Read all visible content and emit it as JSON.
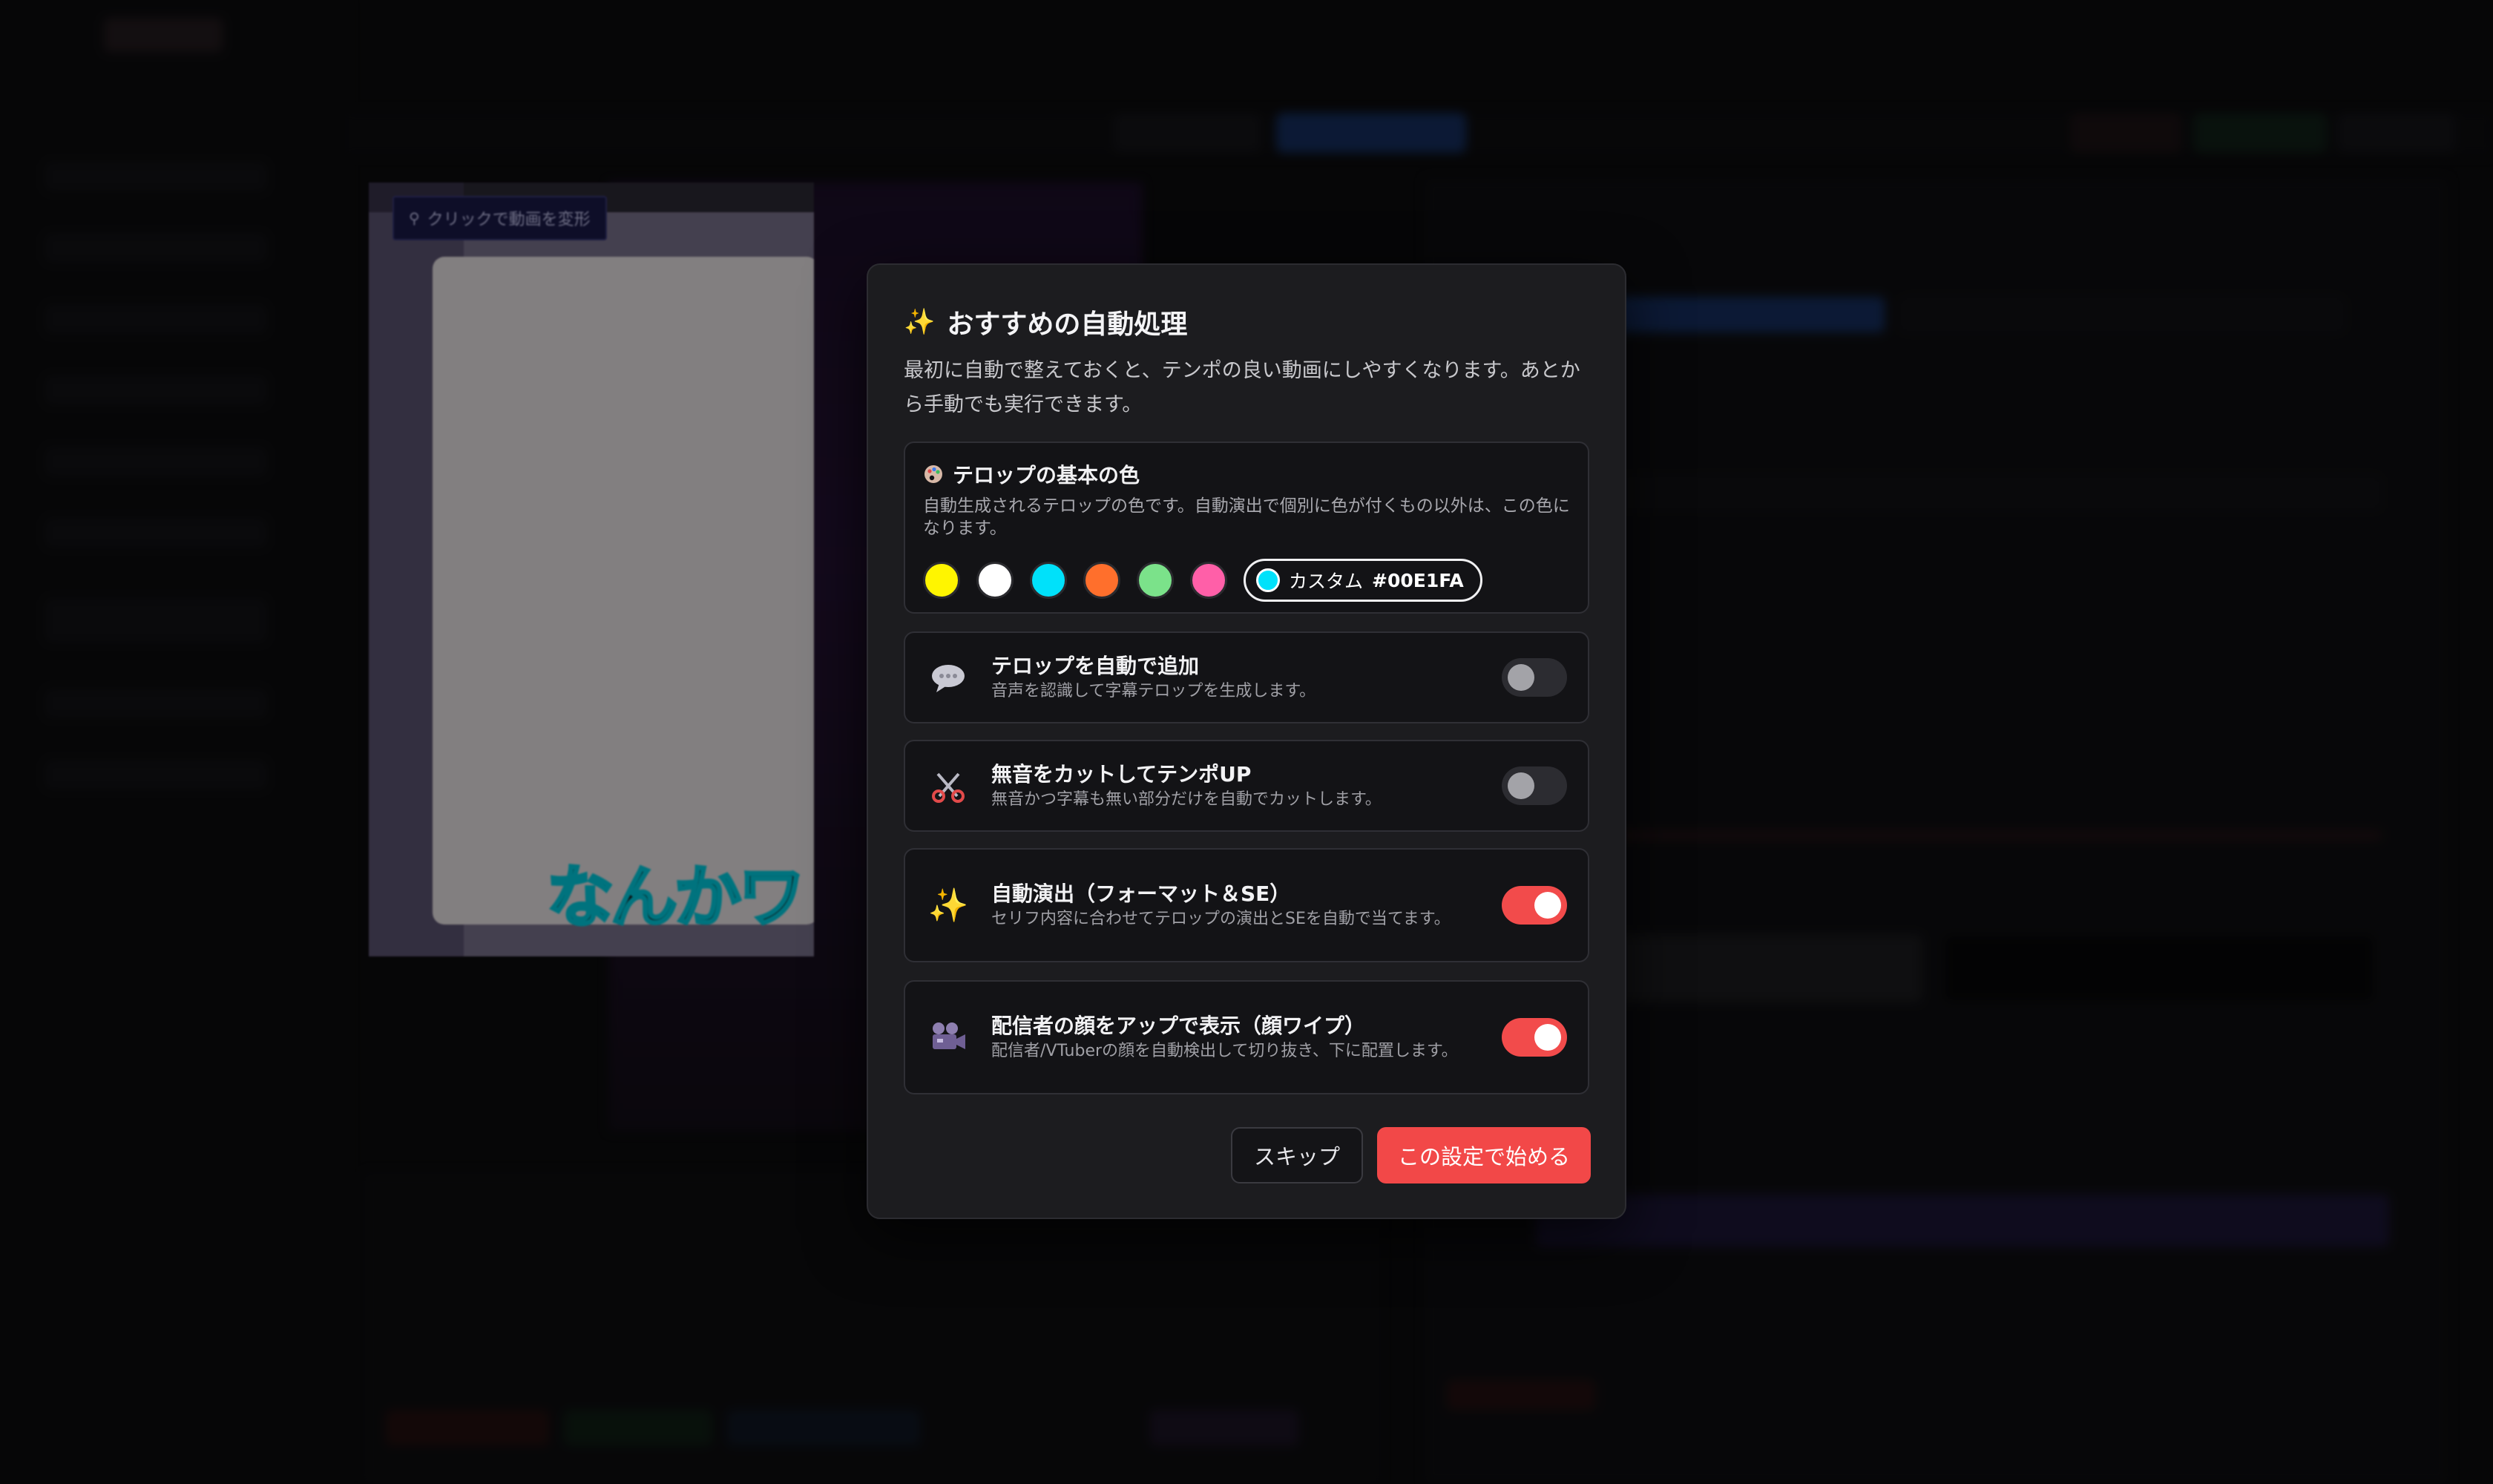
{
  "preview": {
    "hint": "クリックで動画を変形",
    "caption": "なんかワ"
  },
  "modal": {
    "title": "おすすめの自動処理",
    "description": "最初に自動で整えておくと、テンポの良い動画にしやすくなります。あとから手動でも実行できます。",
    "color_section": {
      "title": "テロップの基本の色",
      "subtitle": "自動生成されるテロップの色です。自動演出で個別に色が付くもの以外は、この色になります。",
      "swatches": [
        "#FFF500",
        "#FFFFFF",
        "#00E1FA",
        "#FF6F2C",
        "#7BE28A",
        "#FF5FA8"
      ],
      "custom_label": "カスタム",
      "custom_value": "#00E1FA"
    },
    "options": [
      {
        "icon": "speech-bubble-icon",
        "title": "テロップを自動で追加",
        "subtitle": "音声を認識して字幕テロップを生成します。",
        "enabled": false
      },
      {
        "icon": "scissors-icon",
        "title": "無音をカットしてテンポUP",
        "subtitle": "無音かつ字幕も無い部分だけを自動でカットします。",
        "enabled": false
      },
      {
        "icon": "sparkles-icon",
        "title": "自動演出（フォーマット＆SE）",
        "subtitle": "セリフ内容に合わせてテロップの演出とSEを自動で当てます。",
        "enabled": true
      },
      {
        "icon": "video-camera-icon",
        "title": "配信者の顔をアップで表示（顔ワイプ）",
        "subtitle": "配信者/VTuberの顔を自動検出して切り抜き、下に配置します。",
        "enabled": true
      }
    ],
    "skip_label": "スキップ",
    "start_label": "この設定で始める"
  }
}
